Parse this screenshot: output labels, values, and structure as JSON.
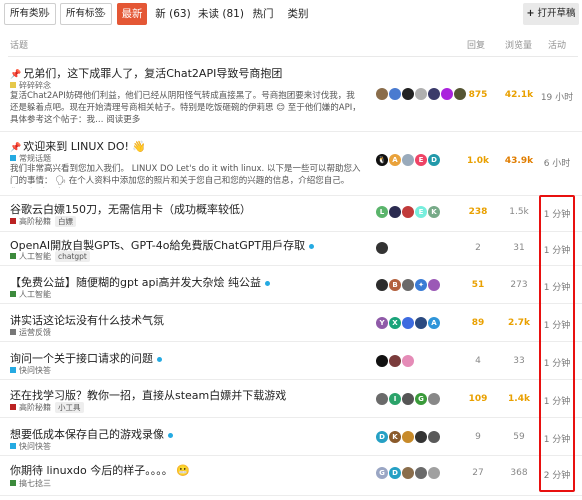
{
  "filters": {
    "category_label": "所有类别",
    "tag_label": "所有标签",
    "tabs": [
      "最新",
      "新 (63)",
      "未读 (81)",
      "热门",
      "类别"
    ],
    "draft_label": "打开草稿"
  },
  "header": {
    "topic": "话题",
    "replies": "回复",
    "views": "浏览量",
    "activity": "活动"
  },
  "topics": [
    {
      "title": "兄弟们，这下成罪人了，复活Chat2API导致号商抱团",
      "pinned": true,
      "category": "碎碎碎念",
      "category_color": "#e6c84a",
      "excerpt": "复活Chat2API妨碍他们利益，他们已经从阴阳怪气转成直接黑了。号商抱团要来讨伐我，我还是躲着点吧。现在开始清理号商相关帖子。特别是吃饭砸碗的伊莉思 😊 至于他们嫌的API，具体参考这个帖子：我… 阅读更多",
      "replies": "875",
      "views": "42.1k",
      "activity": "19 小时",
      "avatar_colors": [
        "#8a6d4b",
        "#4a7bd0",
        "#222222",
        "#b0b0b0",
        "#3a3a6a",
        "#a2d",
        "#553"
      ]
    },
    {
      "title": "欢迎来到 LINUX DO! 👋",
      "pinned": true,
      "category": "常规话题",
      "category_color": "#25aae2",
      "excerpt": "我们非常高兴看到您加入我们。 LINUX DO Let's do it with linux. 以下是一些可以帮助您入门的事情： 🗣 在个人资料中添加您的照片和关于您自己和您的兴趣的信息，介绍您自己。您… 阅读更多",
      "replies": "1.0k",
      "views": "43.9k",
      "activity": "6 小时",
      "avatar_colors": [
        "#111111",
        "#e9a23b",
        "#9ab",
        "#e46",
        "#29a"
      ]
    },
    {
      "title": "谷歌云白嫖150刀，无需信用卡（成功概率较低）",
      "category": "高阶秘籍",
      "category_color": "#b22",
      "tags": [
        "白嫖"
      ],
      "replies": "238",
      "views": "1.5k",
      "activity": "1 分钟",
      "avatar_colors": [
        "#5ab46b",
        "#2b2b50",
        "#c13a3a",
        "#7ed",
        "#7a8"
      ]
    },
    {
      "title": "OpenAI開放自製GPTs、GPT-4o給免費版ChatGPT用戶存取",
      "dot": true,
      "category": "人工智能",
      "category_color": "#3c8a3c",
      "tags": [
        "chatgpt"
      ],
      "replies": "2",
      "views": "31",
      "activity": "1 分钟",
      "avatar_colors": [
        "#333333"
      ]
    },
    {
      "title": "【免费公益】随便糊的gpt api高并发大杂烩 纯公益",
      "dot": true,
      "category": "人工智能",
      "category_color": "#3c8a3c",
      "replies": "51",
      "views": "273",
      "activity": "1 分钟",
      "avatar_colors": [
        "#2d2d2d",
        "#b3603d",
        "#6a6a6a",
        "#3a7bd5",
        "#9b59b6"
      ]
    },
    {
      "title": "讲实话这论坛没有什么技术气氛",
      "category": "运营反馈",
      "category_color": "#777777",
      "replies": "89",
      "views": "2.7k",
      "activity": "1 分钟",
      "avatar_colors": [
        "#8f5aa8",
        "#1aa37a",
        "#3d6be0",
        "#2b4a80",
        "#2f95d9"
      ]
    },
    {
      "title": "询问一个关于接口请求的问题",
      "dot": true,
      "category": "快问快答",
      "category_color": "#25aae2",
      "replies": "4",
      "views": "33",
      "activity": "1 分钟",
      "avatar_colors": [
        "#111111",
        "#7a3b3b",
        "#e58bb7"
      ]
    },
    {
      "title": "还在找学习版？教你一招，直接从steam白嫖并下载游戏",
      "category": "高阶秘籍",
      "category_color": "#b22",
      "tags": [
        "小工具"
      ],
      "replies": "109",
      "views": "1.4k",
      "activity": "1 分钟",
      "avatar_colors": [
        "#6a6a6a",
        "#2ba36a",
        "#555555",
        "#3a9a3a",
        "#888888"
      ]
    },
    {
      "title": "想要低成本保存自己的游戏录像",
      "dot": true,
      "category": "快问快答",
      "category_color": "#25aae2",
      "replies": "9",
      "views": "59",
      "activity": "1 分钟",
      "avatar_colors": [
        "#25a0c4",
        "#8a5a2a",
        "#c78a2a",
        "#333333",
        "#5a5a5a"
      ]
    },
    {
      "title": "你期待 linuxdo 今后的样子。。。。 😬",
      "category": "搞七捻三",
      "category_color": "#3c8a3c",
      "replies": "27",
      "views": "368",
      "activity": "2 分钟",
      "avatar_colors": [
        "#9aa6c4",
        "#25a0c4",
        "#8a6d4b",
        "#6a6a6a",
        "#a0a0a0"
      ]
    }
  ]
}
